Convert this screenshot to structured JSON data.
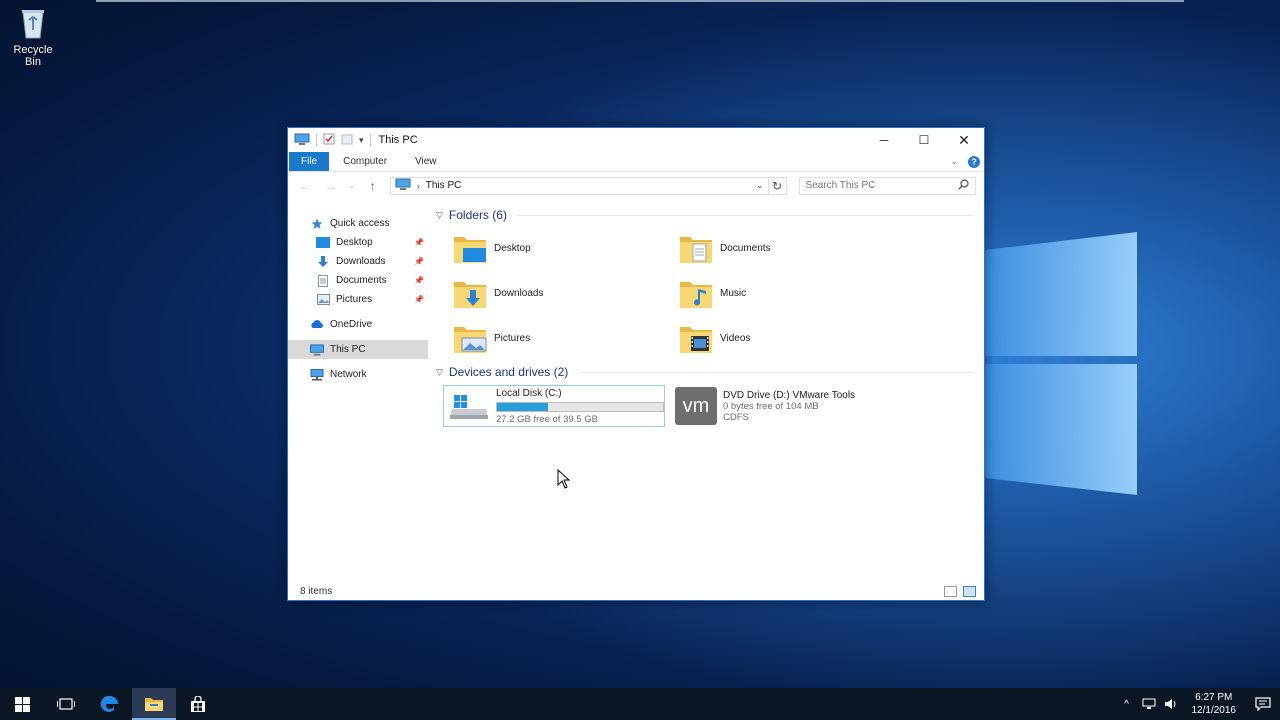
{
  "desktop": {
    "recycle_bin_label": "Recycle Bin"
  },
  "window": {
    "title": "This PC",
    "ribbon_tabs": [
      "File",
      "Computer",
      "View"
    ],
    "address_path": "This PC",
    "search_placeholder": "Search This PC",
    "nav": {
      "quick_access": "Quick access",
      "desktop": "Desktop",
      "downloads": "Downloads",
      "documents": "Documents",
      "pictures": "Pictures",
      "onedrive": "OneDrive",
      "this_pc": "This PC",
      "network": "Network"
    },
    "folders_header": "Folders (6)",
    "folders": [
      {
        "name": "Desktop",
        "icon": "desktop-folder-icon"
      },
      {
        "name": "Documents",
        "icon": "documents-folder-icon"
      },
      {
        "name": "Downloads",
        "icon": "downloads-folder-icon"
      },
      {
        "name": "Music",
        "icon": "music-folder-icon"
      },
      {
        "name": "Pictures",
        "icon": "pictures-folder-icon"
      },
      {
        "name": "Videos",
        "icon": "videos-folder-icon"
      }
    ],
    "devices_header": "Devices and drives (2)",
    "drives": [
      {
        "name": "Local Disk (C:)",
        "space": "27.2 GB free of 39.5 GB",
        "used_fraction": 0.31
      },
      {
        "name": "DVD Drive (D:) VMware Tools",
        "space": "0 bytes free of 104 MB",
        "fs": "CDFS"
      }
    ],
    "status": "8 items"
  },
  "taskbar": {
    "time": "6:27 PM",
    "date": "12/1/2016"
  },
  "colors": {
    "accent": "#1979ca",
    "folder_yellow": "#f8d775",
    "drive_bar": "#26a0da",
    "group_header": "#1e3287"
  }
}
